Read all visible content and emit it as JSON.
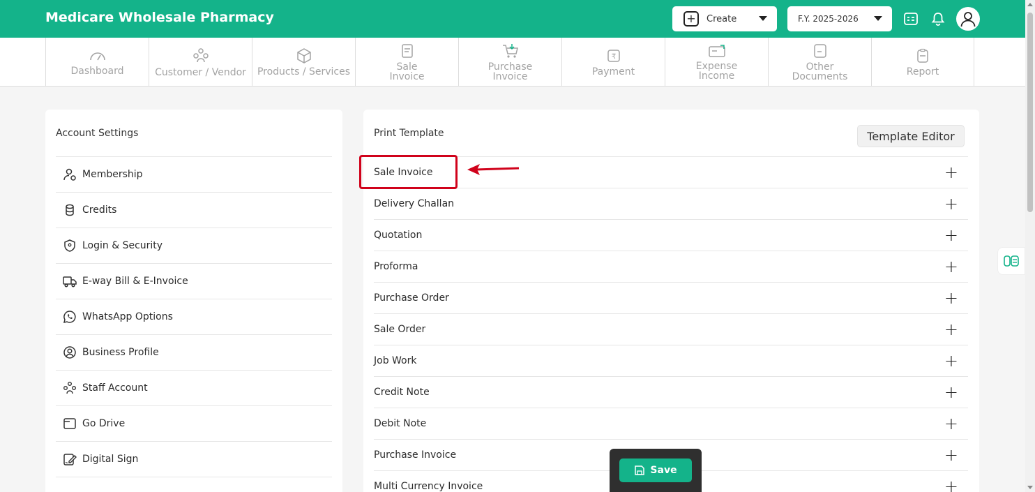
{
  "header": {
    "app_title": "Medicare Wholesale Pharmacy",
    "create_label": "Create",
    "fy_label": "F.Y. 2025-2026",
    "icons": [
      "calculator-icon",
      "bell-icon",
      "user-icon"
    ]
  },
  "nav": {
    "items": [
      {
        "label": "Dashboard",
        "icon": "gauge-icon"
      },
      {
        "label": "Customer / Vendor",
        "icon": "people-icon"
      },
      {
        "label": "Products / Services",
        "icon": "box-icon"
      },
      {
        "label": "Sale Invoice",
        "icon": "invoice-icon"
      },
      {
        "label": "Purchase Invoice",
        "icon": "cart-icon"
      },
      {
        "label": "Payment",
        "icon": "rupee-icon"
      },
      {
        "label": "Expense Income",
        "icon": "expense-icon"
      },
      {
        "label": "Other Documents",
        "icon": "documents-icon"
      },
      {
        "label": "Report",
        "icon": "clipboard-icon"
      }
    ]
  },
  "account_settings": {
    "title": "Account Settings",
    "items": [
      {
        "label": "Membership",
        "icon": "membership-icon"
      },
      {
        "label": "Credits",
        "icon": "coins-icon"
      },
      {
        "label": "Login & Security",
        "icon": "shield-icon"
      },
      {
        "label": "E-way Bill & E-Invoice",
        "icon": "truck-icon"
      },
      {
        "label": "WhatsApp Options",
        "icon": "whatsapp-icon"
      },
      {
        "label": "Business Profile",
        "icon": "profile-icon"
      },
      {
        "label": "Staff Account",
        "icon": "staff-icon"
      },
      {
        "label": "Go Drive",
        "icon": "drive-icon"
      },
      {
        "label": "Digital Sign",
        "icon": "sign-icon"
      }
    ]
  },
  "print_template": {
    "title": "Print Template",
    "editor_button": "Template Editor",
    "items": [
      "Sale Invoice",
      "Delivery Challan",
      "Quotation",
      "Proforma",
      "Purchase Order",
      "Sale Order",
      "Job Work",
      "Credit Note",
      "Debit Note",
      "Purchase Invoice",
      "Multi Currency Invoice"
    ]
  },
  "save_label": "Save",
  "colors": {
    "brand": "#14b38a",
    "highlight": "#d0021b"
  }
}
